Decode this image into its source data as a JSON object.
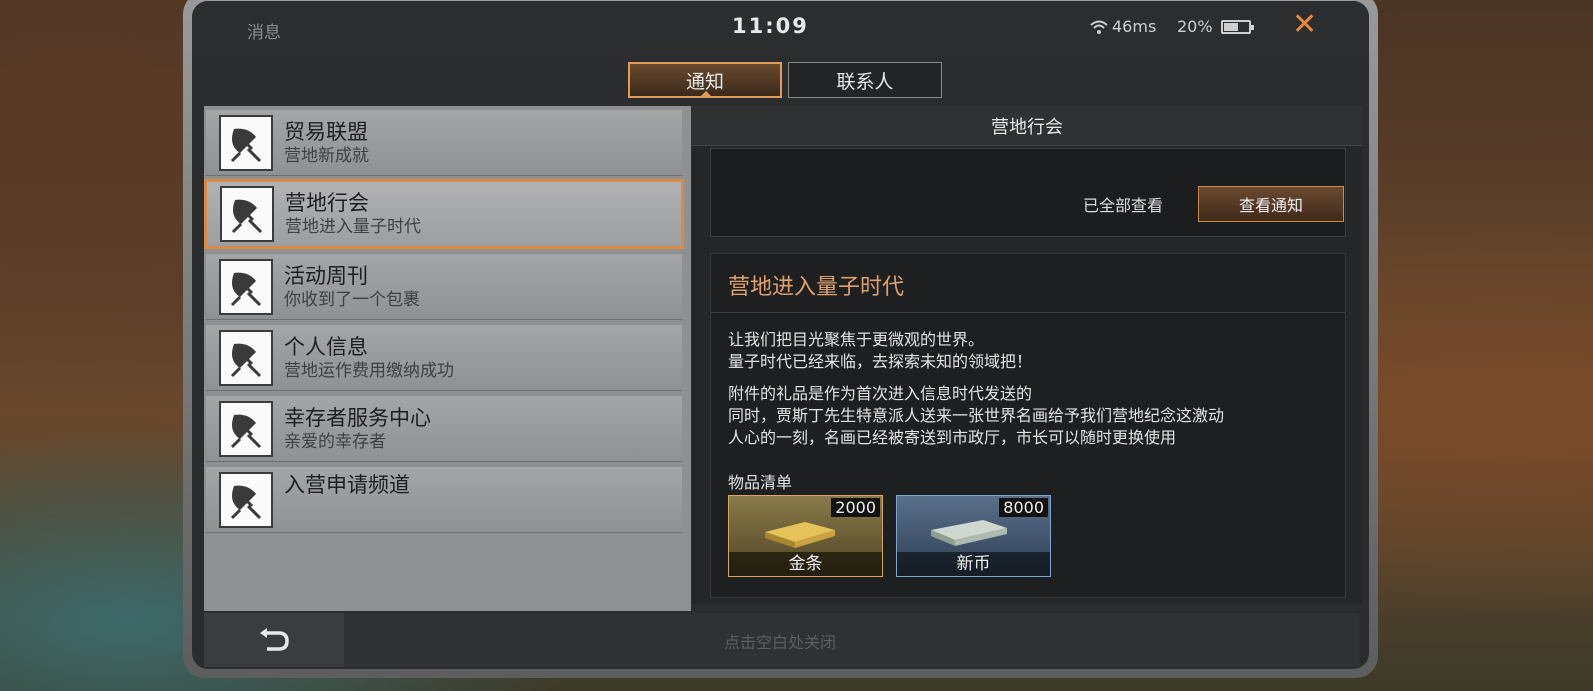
{
  "status": {
    "title": "消息",
    "clock": "11:09",
    "ping": "46ms",
    "battery_pct": "20%",
    "battery_level": 0.6
  },
  "tabs": [
    {
      "label": "通知"
    },
    {
      "label": "联系人"
    }
  ],
  "list": [
    {
      "name": "贸易联盟",
      "sub": "营地新成就"
    },
    {
      "name": "营地行会",
      "sub": "营地进入量子时代"
    },
    {
      "name": "活动周刊",
      "sub": "你收到了一个包裹"
    },
    {
      "name": "个人信息",
      "sub": "营地运作费用缴纳成功"
    },
    {
      "name": "幸存者服务中心",
      "sub": "亲爱的幸存者"
    },
    {
      "name": "入营申请频道",
      "sub": ""
    }
  ],
  "detail": {
    "header": "营地行会",
    "all_read": "已全部查看",
    "view_button": "查看通知",
    "title": "营地进入量子时代",
    "para1_l1": "让我们把目光聚焦于更微观的世界。",
    "para1_l2": "量子时代已经来临，去探索未知的领域把！",
    "para2_l1": "附件的礼品是作为首次进入信息时代发送的",
    "para2_l2": "同时，贾斯丁先生特意派人送来一张世界名画给予我们营地纪念这激动",
    "para2_l3": "人心的一刻，名画已经被寄送到市政厅，市长可以随时更换使用",
    "items_label": "物品清单",
    "goods": [
      {
        "name": "金条",
        "qty": "2000"
      },
      {
        "name": "新币",
        "qty": "8000"
      }
    ]
  },
  "bottom": {
    "hint": "点击空白处关闭"
  },
  "colors": {
    "accent": "#d98a45"
  }
}
